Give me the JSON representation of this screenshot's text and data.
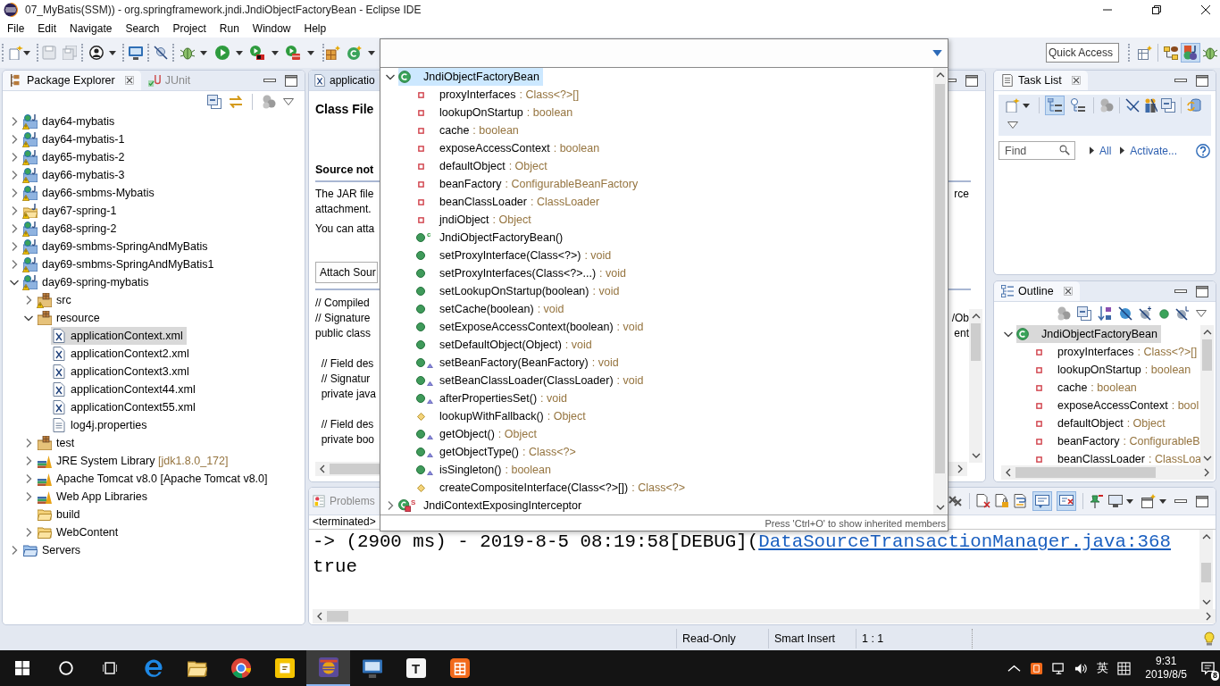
{
  "window": {
    "title": "07_MyBatis(SSM)) - org.springframework.jndi.JndiObjectFactoryBean - Eclipse IDE"
  },
  "menu": [
    "File",
    "Edit",
    "Navigate",
    "Search",
    "Project",
    "Run",
    "Window",
    "Help"
  ],
  "toolbar": {
    "quick_access": {
      "placeholder": "Quick Access"
    },
    "perspectives": [
      {
        "kind": "open",
        "selected": false
      },
      {
        "kind": "java",
        "selected": false
      },
      {
        "kind": "javaee",
        "selected": true
      },
      {
        "kind": "debug",
        "selected": false
      }
    ]
  },
  "package_explorer": {
    "tabs": [
      {
        "label": "Package Explorer",
        "kind": "packages",
        "selected": true
      },
      {
        "label": "JUnit",
        "kind": "junit",
        "selected": false
      }
    ],
    "tree": [
      {
        "label": "day64-mybatis",
        "kind": "web-project",
        "warning": true,
        "expanded": false,
        "selected": false
      },
      {
        "label": "day64-mybatis-1",
        "kind": "web-project",
        "warning": true,
        "expanded": false,
        "selected": false
      },
      {
        "label": "day65-mybatis-2",
        "kind": "web-project",
        "warning": true,
        "expanded": false,
        "selected": false
      },
      {
        "label": "day66-mybatis-3",
        "kind": "web-project",
        "warning": true,
        "expanded": false,
        "selected": false
      },
      {
        "label": "day66-smbms-Mybatis",
        "kind": "web-project",
        "warning": true,
        "expanded": false,
        "selected": false
      },
      {
        "label": "day67-spring-1",
        "kind": "java-project",
        "warning": true,
        "expanded": false,
        "selected": false
      },
      {
        "label": "day68-spring-2",
        "kind": "web-project",
        "warning": true,
        "expanded": false,
        "selected": false
      },
      {
        "label": "day69-smbms-SpringAndMyBatis",
        "kind": "web-project",
        "warning": true,
        "expanded": false,
        "selected": false
      },
      {
        "label": "day69-smbms-SpringAndMyBatis1",
        "kind": "web-project",
        "warning": true,
        "expanded": false,
        "selected": false
      },
      {
        "label": "day69-spring-mybatis",
        "kind": "web-project",
        "warning": true,
        "expanded": true,
        "selected": false,
        "children": [
          {
            "label": "src",
            "kind": "source-folder",
            "warning": true,
            "expanded": false,
            "selected": false
          },
          {
            "label": "resource",
            "kind": "source-folder",
            "warning": false,
            "expanded": true,
            "selected": false,
            "children": [
              {
                "label": "applicationContext.xml",
                "kind": "xml-file",
                "warning": false,
                "selected": true
              },
              {
                "label": "applicationContext2.xml",
                "kind": "xml-file",
                "warning": false,
                "selected": false
              },
              {
                "label": "applicationContext3.xml",
                "kind": "xml-file",
                "warning": false,
                "selected": false
              },
              {
                "label": "applicationContext44.xml",
                "kind": "xml-file",
                "warning": false,
                "selected": false
              },
              {
                "label": "applicationContext55.xml",
                "kind": "xml-file",
                "warning": false,
                "selected": false
              },
              {
                "label": "log4j.properties",
                "kind": "text-file",
                "warning": false,
                "selected": false
              }
            ]
          },
          {
            "label": "test",
            "kind": "source-folder",
            "warning": false,
            "expanded": false,
            "selected": false
          },
          {
            "label": "JRE System Library",
            "decoration": "[jdk1.8.0_172]",
            "kind": "library",
            "warning": false,
            "expanded": false,
            "selected": false
          },
          {
            "label": "Apache Tomcat v8.0 [Apache Tomcat v8.0]",
            "kind": "library",
            "warning": false,
            "expanded": false,
            "selected": false
          },
          {
            "label": "Web App Libraries",
            "kind": "library",
            "warning": false,
            "expanded": false,
            "selected": false
          },
          {
            "label": "build",
            "kind": "folder",
            "warning": false,
            "selected": false
          },
          {
            "label": "WebContent",
            "kind": "folder",
            "warning": false,
            "expanded": false,
            "selected": false
          }
        ]
      },
      {
        "label": "Servers",
        "kind": "server-folder",
        "warning": false,
        "expanded": false,
        "selected": false
      }
    ]
  },
  "editor": {
    "tab": "applicatio",
    "heading": "Class File",
    "section": "Source not",
    "paragraphs": [
      [
        {
          "text": "The JAR file",
          "tail": "rce"
        },
        {
          "text": "attachment."
        }
      ],
      [
        {
          "text": "You can atta"
        }
      ]
    ],
    "attach_button": "Attach Sour",
    "code": [
      [
        {
          "text": "// Compiled"
        },
        {
          "text": "// Signature",
          "tail": "/Ob"
        },
        {
          "text": "public class",
          "tail": "ent"
        }
      ],
      [
        {
          "text": "  // Field des"
        },
        {
          "text": "  // Signatur"
        },
        {
          "text": "  private java"
        }
      ],
      [
        {
          "text": "  // Field des"
        },
        {
          "text": "  private boo"
        }
      ]
    ]
  },
  "quick_outline": {
    "tree": [
      {
        "name": "JndiObjectFactoryBean",
        "kind": "class",
        "expanded": true,
        "selected": true,
        "children": [
          {
            "name": "proxyInterfaces",
            "type": ": Class<?>[]",
            "kind": "field",
            "overrides": false,
            "selected": false
          },
          {
            "name": "lookupOnStartup",
            "type": ": boolean",
            "kind": "field",
            "overrides": false,
            "selected": false
          },
          {
            "name": "cache",
            "type": ": boolean",
            "kind": "field",
            "overrides": false,
            "selected": false
          },
          {
            "name": "exposeAccessContext",
            "type": ": boolean",
            "kind": "field",
            "overrides": false,
            "selected": false
          },
          {
            "name": "defaultObject",
            "type": ": Object",
            "kind": "field",
            "overrides": false,
            "selected": false
          },
          {
            "name": "beanFactory",
            "type": ": ConfigurableBeanFactory",
            "kind": "field",
            "overrides": false,
            "selected": false
          },
          {
            "name": "beanClassLoader",
            "type": ": ClassLoader",
            "kind": "field",
            "overrides": false,
            "selected": false
          },
          {
            "name": "jndiObject",
            "type": ": Object",
            "kind": "field",
            "overrides": false,
            "selected": false
          },
          {
            "name": "JndiObjectFactoryBean()",
            "kind": "constructor",
            "badge": "c",
            "overrides": false,
            "selected": false
          },
          {
            "name": "setProxyInterface(Class<?>)",
            "type": ": void",
            "kind": "method",
            "overrides": false,
            "selected": false
          },
          {
            "name": "setProxyInterfaces(Class<?>...)",
            "type": ": void",
            "kind": "method",
            "overrides": false,
            "selected": false
          },
          {
            "name": "setLookupOnStartup(boolean)",
            "type": ": void",
            "kind": "method",
            "overrides": false,
            "selected": false
          },
          {
            "name": "setCache(boolean)",
            "type": ": void",
            "kind": "method",
            "overrides": false,
            "selected": false
          },
          {
            "name": "setExposeAccessContext(boolean)",
            "type": ": void",
            "kind": "method",
            "overrides": false,
            "selected": false
          },
          {
            "name": "setDefaultObject(Object)",
            "type": ": void",
            "kind": "method",
            "overrides": false,
            "selected": false
          },
          {
            "name": "setBeanFactory(BeanFactory)",
            "type": ": void",
            "kind": "method",
            "overrides": true,
            "selected": false
          },
          {
            "name": "setBeanClassLoader(ClassLoader)",
            "type": ": void",
            "kind": "method",
            "overrides": true,
            "selected": false
          },
          {
            "name": "afterPropertiesSet()",
            "type": ": void",
            "kind": "method",
            "overrides": true,
            "selected": false
          },
          {
            "name": "lookupWithFallback()",
            "type": ": Object",
            "kind": "protected-method",
            "overrides": false,
            "selected": false
          },
          {
            "name": "getObject()",
            "type": ": Object",
            "kind": "method",
            "overrides": true,
            "selected": false
          },
          {
            "name": "getObjectType()",
            "type": ": Class<?>",
            "kind": "method",
            "overrides": true,
            "selected": false
          },
          {
            "name": "isSingleton()",
            "type": ": boolean",
            "kind": "method",
            "overrides": true,
            "selected": false
          },
          {
            "name": "createCompositeInterface(Class<?>[])",
            "type": ": Class<?>",
            "kind": "protected-method",
            "overrides": false,
            "selected": false
          }
        ]
      },
      {
        "name": "JndiContextExposingInterceptor",
        "kind": "static-class",
        "badge": "S",
        "expanded": false,
        "selected": false
      }
    ],
    "hint": "Press 'Ctrl+O' to show inherited members"
  },
  "task_list": {
    "tab": "Task List",
    "view_modes": [
      {
        "kind": "categorized",
        "selected": true
      },
      {
        "kind": "scheduled",
        "selected": false
      }
    ],
    "find": {
      "placeholder": "Find"
    },
    "links": [
      "All",
      "Activate..."
    ]
  },
  "outline": {
    "tab": "Outline",
    "tree": [
      {
        "name": "JndiObjectFactoryBean",
        "kind": "class",
        "expanded": true,
        "selected": true,
        "children": [
          {
            "name": "proxyInterfaces",
            "type": ": Class<?>[]",
            "kind": "field",
            "overrides": false,
            "selected": false
          },
          {
            "name": "lookupOnStartup",
            "type": ": boolean",
            "kind": "field",
            "overrides": false,
            "selected": false
          },
          {
            "name": "cache",
            "type": ": boolean",
            "kind": "field",
            "overrides": false,
            "selected": false
          },
          {
            "name": "exposeAccessContext",
            "type": ": bool",
            "kind": "field",
            "overrides": false,
            "selected": false
          },
          {
            "name": "defaultObject",
            "type": ": Object",
            "kind": "field",
            "overrides": false,
            "selected": false
          },
          {
            "name": "beanFactory",
            "type": ": ConfigurableB",
            "kind": "field",
            "overrides": false,
            "selected": false
          },
          {
            "name": "beanClassLoader",
            "type": ": ClassLoa",
            "kind": "field",
            "overrides": false,
            "selected": false
          }
        ]
      }
    ]
  },
  "console_panel": {
    "tabs": [
      {
        "label": "Problems",
        "selected": false
      }
    ],
    "toggles": [
      {
        "kind": "stdout",
        "on": true
      },
      {
        "kind": "stderr",
        "on": true
      }
    ],
    "process": "<terminated>",
    "lines": [
      {
        "text": "-> (2900 ms) - 2019-8-5 08:19:58[DEBUG](",
        "link": "DataSourceTransactionManager.java:368"
      },
      {
        "text": "true"
      }
    ]
  },
  "status_bar": [
    "Read-Only",
    "Smart Insert",
    "1 : 1"
  ],
  "taskbar": {
    "apps": [
      {
        "kind": "edge",
        "selected": false
      },
      {
        "kind": "explorer",
        "selected": false
      },
      {
        "kind": "chrome",
        "selected": false
      },
      {
        "kind": "notes",
        "selected": false
      },
      {
        "kind": "eclipse",
        "selected": true
      },
      {
        "kind": "monitor",
        "selected": false
      },
      {
        "kind": "letter",
        "glyph": "T",
        "selected": false
      },
      {
        "kind": "reader",
        "selected": false
      }
    ],
    "tray": {
      "ime": "英",
      "time": "9:31",
      "date": "2019/8/5",
      "notifications": "8"
    }
  }
}
